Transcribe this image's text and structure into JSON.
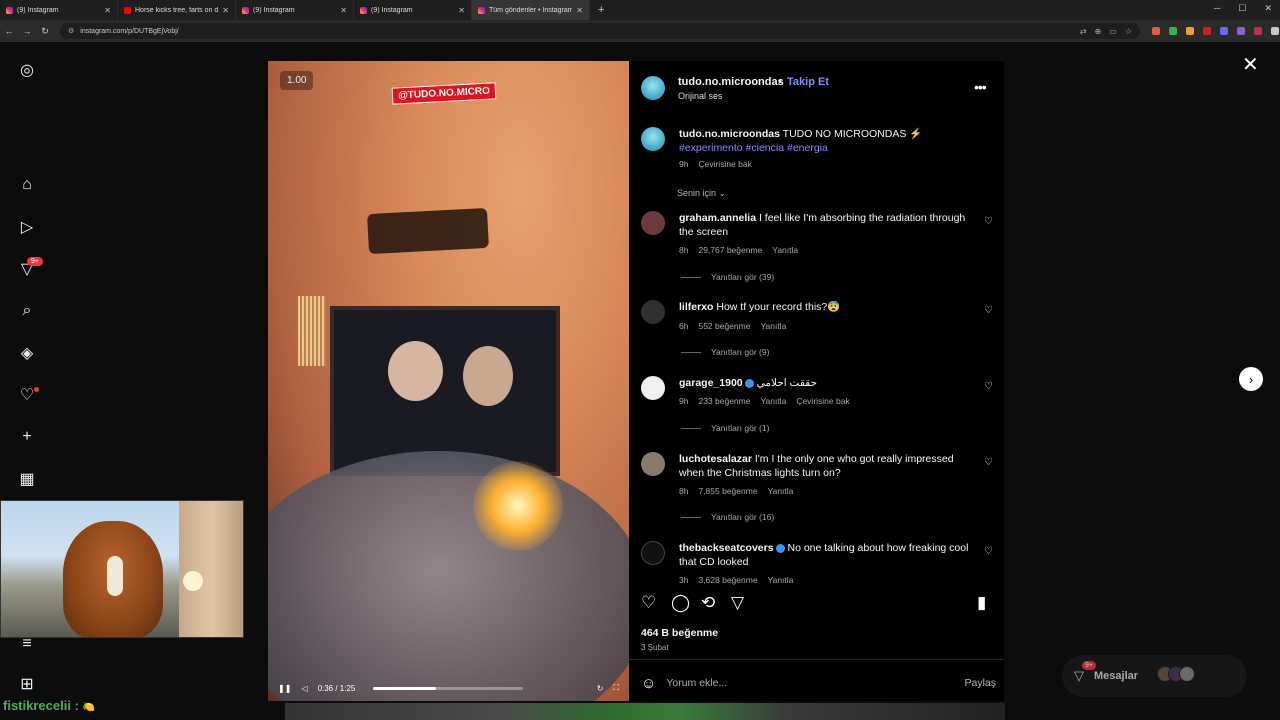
{
  "tabs": [
    {
      "title": "(9) Instagram",
      "icon": "instagram-icon"
    },
    {
      "title": "Horse kicks tree, farts on dog",
      "icon": "youtube-icon"
    },
    {
      "title": "(9) Instagram",
      "icon": "instagram-icon"
    },
    {
      "title": "(9) Instagram",
      "icon": "instagram-icon"
    },
    {
      "title": "Tüm gönderiler • Instagram",
      "icon": "instagram-icon"
    }
  ],
  "address": {
    "url": "instagram.com/p/DUTBgEjVobj/"
  },
  "video": {
    "speed": "1.00",
    "watermark": "@TUDO.NO.MICRO",
    "time": "0:36 / 1:25",
    "progress": 0.42
  },
  "post": {
    "username": "tudo.no.microondas",
    "follow": "Takip Et",
    "audio": "Orijinal ses",
    "caption_user": "tudo.no.microondas",
    "caption_text": "TUDO NO MICROONDAS ⚡",
    "caption_tags": "#experimento #ciencia #energia",
    "caption_age": "9h",
    "caption_translate": "Çevirisine bak",
    "sort_label": "Senin için ⌄",
    "likes": "464 B beğenme",
    "date": "3 Şubat",
    "comment_placeholder": "Yorum ekle...",
    "share": "Paylaş"
  },
  "comments": [
    {
      "user": "graham.annelia",
      "text": "I feel like I'm absorbing the radiation through the screen",
      "age": "8h",
      "likes": "29,767 beğenme",
      "reply": "Yanıtla",
      "replies": "Yanıtları gör (39)",
      "avatar_color": "#6b3a3a"
    },
    {
      "user": "lilferxo",
      "text": "How tf your record this?😨",
      "age": "6h",
      "likes": "552 beğenme",
      "reply": "Yanıtla",
      "replies": "Yanıtları gör (9)",
      "avatar_color": "#2f2f2f"
    },
    {
      "user": "garage_1900",
      "text": "حققت احلامي",
      "age": "9h",
      "likes": "233 beğenme",
      "reply": "Yanıtla",
      "translate": "Çevirisine bak",
      "replies": "Yanıtları gör (1)",
      "avatar_color": "#f0f0f0",
      "verified": true
    },
    {
      "user": "luchotesalazar",
      "text": "I'm I the only one who got really impressed when the Christmas lights turn on?",
      "age": "8h",
      "likes": "7,855 beğenme",
      "reply": "Yanıtla",
      "replies": "Yanıtları gör (16)",
      "avatar_color": "#8a7a6a"
    },
    {
      "user": "thebackseatcovers",
      "text": "No one talking about how freaking cool that CD looked",
      "age": "3h",
      "likes": "3,628 beğenme",
      "reply": "Yanıtla",
      "avatar_color": "#111111",
      "verified": true
    }
  ],
  "messages": {
    "label": "Mesajlar",
    "badge": "9+"
  },
  "sidebar_badge": "9+",
  "chat": {
    "user": "fistikrecelii",
    "sep": ":",
    "emote": "🍋"
  },
  "colors": {
    "accent": "#7f8fff",
    "badge": "#ff3040",
    "verified": "#3897f0"
  }
}
